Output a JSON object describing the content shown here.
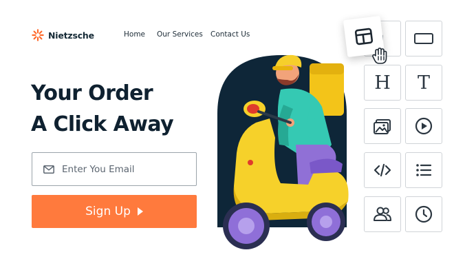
{
  "brand": {
    "name": "Nietzsche",
    "accent": "#ff7a3d",
    "dark": "#0f2130"
  },
  "nav": {
    "home": "Home",
    "services": "Our Services",
    "contact": "Contact Us"
  },
  "hero": {
    "headline_line1": "Your Order",
    "headline_line2": "A Click Away",
    "email_placeholder": "Enter You Email",
    "signup_label": "Sign Up",
    "illustration": "delivery-rider-on-yellow-scooter"
  },
  "widgets": {
    "dragging": "layout-block-icon",
    "tiles": [
      "section-block-icon",
      "heading-block-icon",
      "text-block-icon",
      "image-block-icon",
      "video-block-icon",
      "code-block-icon",
      "list-block-icon",
      "team-block-icon",
      "countdown-block-icon"
    ],
    "heading_glyph": "H",
    "text_glyph": "T"
  }
}
